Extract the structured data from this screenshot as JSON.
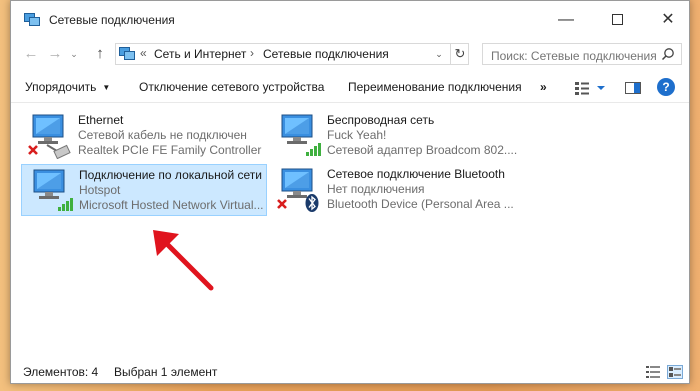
{
  "window": {
    "title": "Сетевые подключения",
    "minimize_glyph": "—",
    "close_glyph": "✕"
  },
  "nav": {
    "back_glyph": "←",
    "forward_glyph": "→",
    "history_glyph": "⌄",
    "up_glyph": "↑",
    "breadcrumb_prefix": "«",
    "breadcrumbs": [
      "Сеть и Интернет",
      "Сетевые подключения"
    ],
    "separator": "›",
    "dropdown_glyph": "⌄",
    "refresh_glyph": "↻",
    "search_placeholder": "Поиск: Сетевые подключения"
  },
  "commands": {
    "organize": "Упорядочить",
    "dropdown_glyph": "▼",
    "disable": "Отключение сетевого устройства",
    "rename": "Переименование подключения",
    "more": "»",
    "help": "?"
  },
  "connections": [
    {
      "name": "Ethernet",
      "status": "Сетевой кабель не подключен",
      "device": "Realtek PCIe FE Family Controller",
      "icon": "ethernet-cable-icon",
      "state": "disconnected",
      "selected": false
    },
    {
      "name": "Беспроводная сеть",
      "status": "Fuck Yeah!",
      "device": "Сетевой адаптер Broadcom 802....",
      "icon": "wifi-signal-icon",
      "state": "connected",
      "selected": false
    },
    {
      "name": "Подключение по локальной сети",
      "status": "Hotspot",
      "device": "Microsoft Hosted Network Virtual...",
      "icon": "wifi-signal-icon",
      "state": "connected",
      "selected": true
    },
    {
      "name": "Сетевое подключение Bluetooth",
      "status": "Нет подключения",
      "device": "Bluetooth Device (Personal Area ...",
      "icon": "bluetooth-icon",
      "state": "disconnected",
      "selected": false
    }
  ],
  "status_bar": {
    "item_count": "Элементов: 4",
    "selection": "Выбран 1 элемент"
  },
  "colors": {
    "selection_bg": "#cce8ff",
    "selection_border": "#99d1ff",
    "annotation_arrow": "#e0141e",
    "disconnected_x": "#d81e1e",
    "signal_green": "#3fb03f",
    "help_blue": "#1e6fcc"
  }
}
